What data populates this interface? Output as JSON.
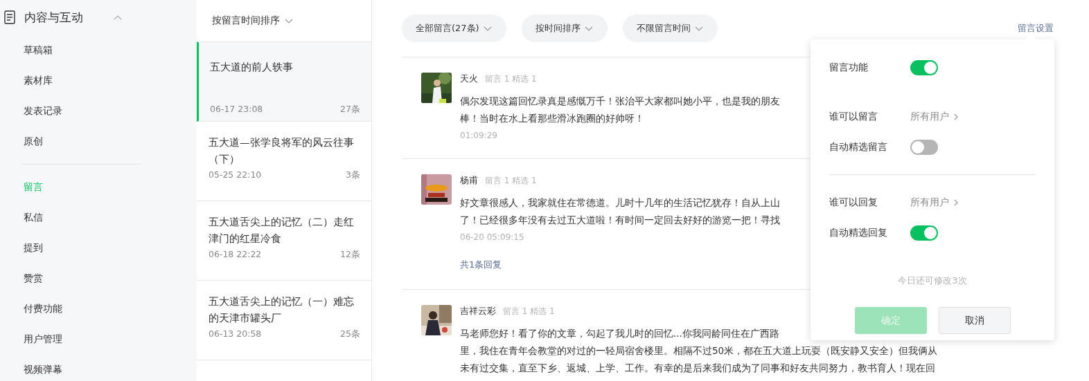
{
  "sidebar": {
    "section": {
      "title": "内容与互动",
      "expanded": true
    },
    "groups": [
      [
        {
          "label": "草稿箱",
          "selected": false
        },
        {
          "label": "素材库",
          "selected": false
        },
        {
          "label": "发表记录",
          "selected": false
        },
        {
          "label": "原创",
          "selected": false
        }
      ],
      [
        {
          "label": "留言",
          "selected": true
        },
        {
          "label": "私信",
          "selected": false
        },
        {
          "label": "提到",
          "selected": false
        },
        {
          "label": "赞赏",
          "selected": false
        },
        {
          "label": "付费功能",
          "selected": false
        },
        {
          "label": "用户管理",
          "selected": false
        },
        {
          "label": "视频弹幕",
          "selected": false
        }
      ]
    ]
  },
  "article_list": {
    "sort_label": "按留言时间排序",
    "articles": [
      {
        "title": "五大道的前人轶事",
        "date": "06-17 23:08",
        "count": "27条",
        "selected": true
      },
      {
        "title": "五大道—张学良将军的风云往事（下）",
        "date": "05-25 22:10",
        "count": "3条",
        "selected": false
      },
      {
        "title": "五大道舌尖上的记忆（二）走红津门的红星冷食",
        "date": "06-18 22:22",
        "count": "12条",
        "selected": false
      },
      {
        "title": "五大道舌尖上的记忆（一）难忘的天津市罐头厂",
        "date": "06-13 20:58",
        "count": "25条",
        "selected": false
      }
    ]
  },
  "filters": [
    "全部留言(27条)",
    "按时间排序",
    "不限留言时间"
  ],
  "settings_link": "留言设置",
  "comments": [
    {
      "name": "天火",
      "stats": "留言 1 精选 1",
      "lines": [
        "偶尔发现这篇回忆录真是感慨万千！张治平大家都叫她小平，也是我的朋友",
        "棒！当时在水上看那些滑冰跑圈的好帅呀！"
      ],
      "time": "01:09:29"
    },
    {
      "name": "杨甫",
      "stats": "留言 1 精选 1",
      "lines": [
        "好文章很感人，我家就住在常德道。儿时十几年的生活记忆犹存！自从上山",
        "了！已经很多年没有去过五大道啦！有时间一定回去好好的游览一把！寻找"
      ],
      "time": "06-20 05:09:15",
      "replies": "共1条回复"
    },
    {
      "name": "吉祥云彩",
      "stats": "留言 1 精选 1",
      "lines": [
        "马老师您好！看了你的文章，勾起了我儿时的回忆...你我同龄同住在广西路",
        "里，我住在青年会教堂的对过的一轻局宿舍楼里。相隔不过50米，都在五大道上玩耍（既安静又安全）但我俩从",
        "未有过交集，直至下乡、返城、上学、工作。有幸的是后来我们成为了同事和好友共同努力，教书育人！现在回"
      ]
    }
  ],
  "settings_popover": {
    "rows": [
      {
        "kind": "toggle",
        "label": "留言功能",
        "on": true
      },
      {
        "kind": "select",
        "label": "谁可以留言",
        "value": "所有用户"
      },
      {
        "kind": "toggle",
        "label": "自动精选留言",
        "on": false
      },
      {
        "kind": "divider"
      },
      {
        "kind": "select",
        "label": "谁可以回复",
        "value": "所有用户"
      },
      {
        "kind": "toggle",
        "label": "自动精选回复",
        "on": true
      }
    ],
    "hint": "今日还可修改3次",
    "buttons": [
      {
        "label": "确定",
        "kind": "primary",
        "disabled": true
      },
      {
        "label": "取消",
        "kind": "default",
        "disabled": false
      }
    ]
  }
}
